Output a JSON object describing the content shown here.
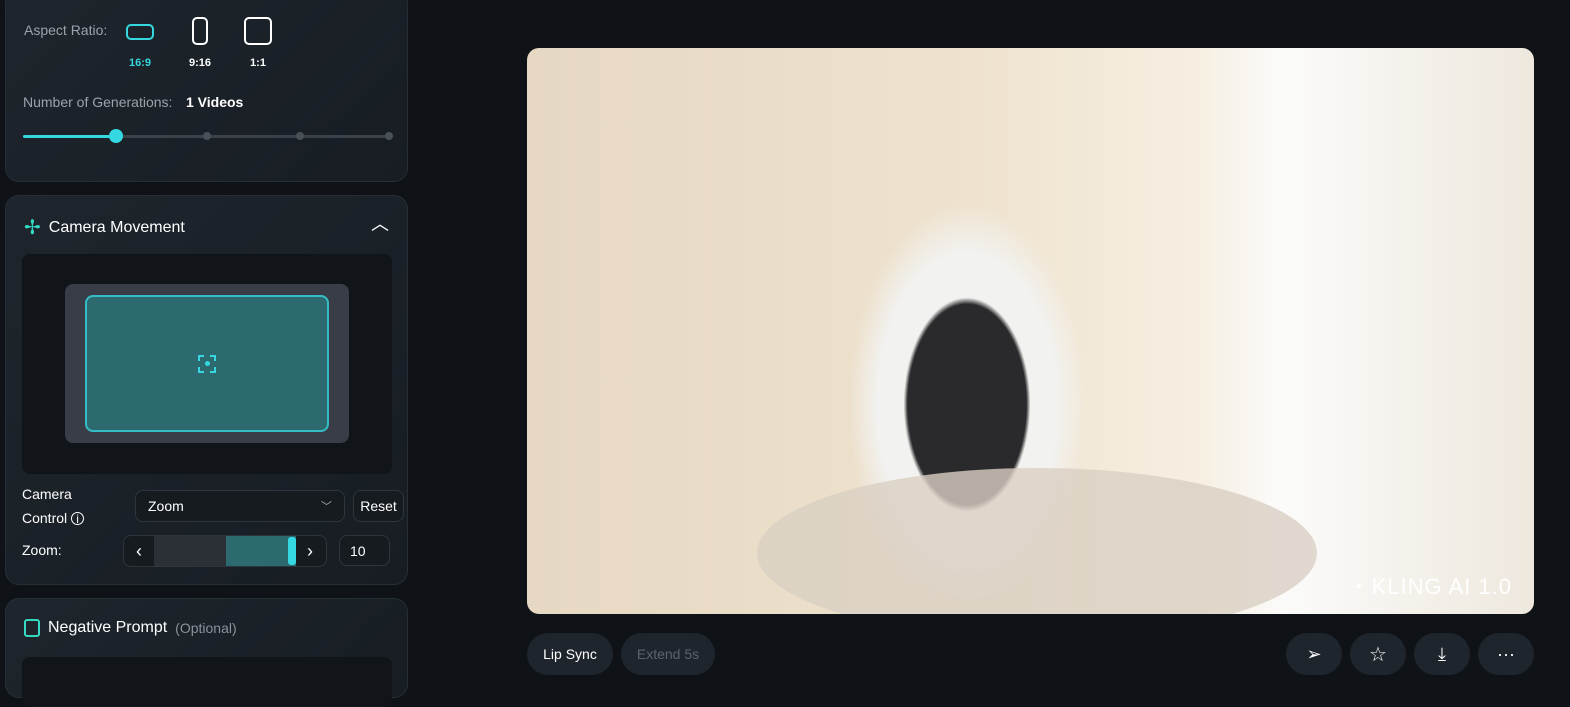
{
  "settings": {
    "aspect_label": "Aspect Ratio:",
    "aspect_options": [
      {
        "label": "16:9",
        "selected": true
      },
      {
        "label": "9:16",
        "selected": false
      },
      {
        "label": "1:1",
        "selected": false
      }
    ],
    "generations_label": "Number of Generations:",
    "generations_value": "1 Videos",
    "generations_slider": {
      "value": 1,
      "min": 1,
      "max": 4
    }
  },
  "camera": {
    "title": "Camera Movement",
    "control_label_1": "Camera",
    "control_label_2": "Control",
    "control_value": "Zoom",
    "reset": "Reset",
    "zoom_label": "Zoom:",
    "zoom_value": "10"
  },
  "negative": {
    "title": "Negative Prompt",
    "optional": "(Optional)"
  },
  "video": {
    "watermark": "KLING AI 1.0"
  },
  "actions": {
    "lip_sync": "Lip Sync",
    "extend": "Extend 5s"
  },
  "colors": {
    "accent": "#35d8e0",
    "bg": "#0f1318"
  }
}
